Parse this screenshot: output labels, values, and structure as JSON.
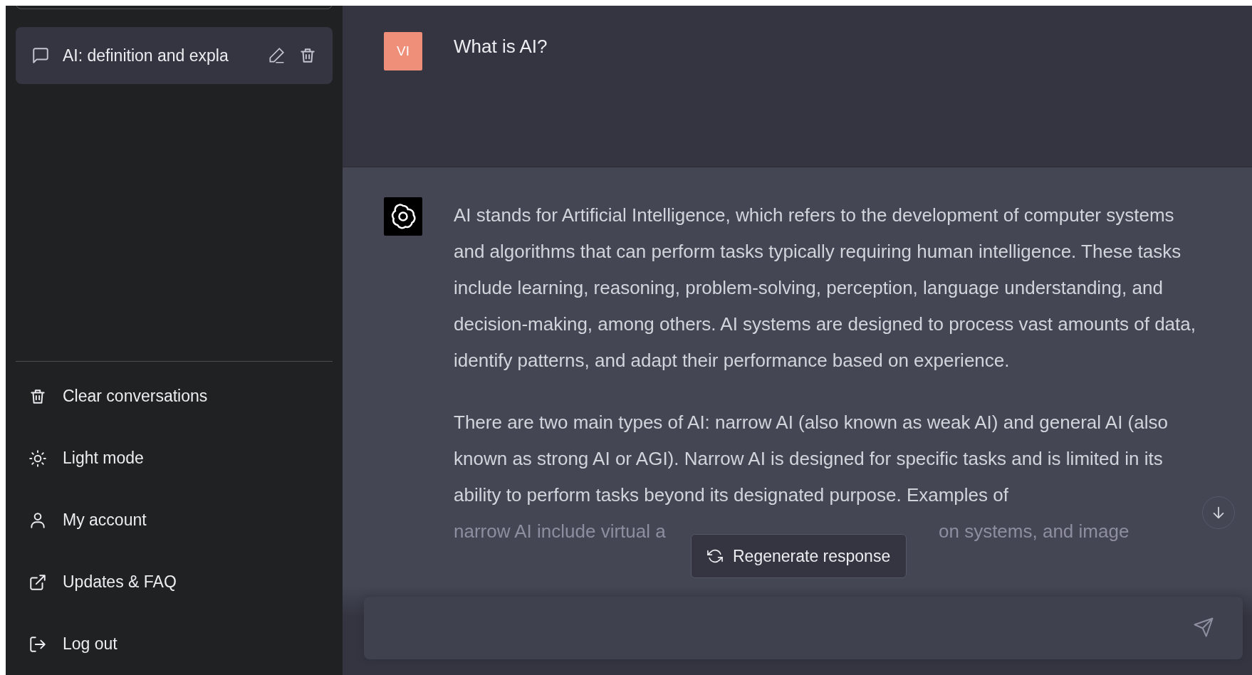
{
  "sidebar": {
    "conversations": [
      {
        "title": "AI: definition and expla",
        "selected": true
      }
    ],
    "menu": [
      {
        "label": "Clear conversations",
        "kind": "trash"
      },
      {
        "label": "Light mode",
        "kind": "sun"
      },
      {
        "label": "My account",
        "kind": "user"
      },
      {
        "label": "Updates & FAQ",
        "kind": "external"
      },
      {
        "label": "Log out",
        "kind": "logout"
      }
    ]
  },
  "chat": {
    "messages": [
      {
        "kind": "user",
        "avatar": "VI",
        "paragraphs": [
          "What is AI?"
        ]
      },
      {
        "kind": "assistant",
        "paragraphs": [
          "AI stands for Artificial Intelligence, which refers to the development of computer systems and algorithms that can perform tasks typically requiring human intelligence. These tasks include learning, reasoning, problem-solving, perception, language understanding, and decision-making, among others. AI systems are designed to process vast amounts of data, identify patterns, and adapt their performance based on experience.",
          "There are two main types of AI: narrow AI (also known as weak AI) and general AI (also known as strong AI or AGI). Narrow AI is designed for specific tasks and is limited in its ability to perform tasks beyond its designated purpose. Examples of"
        ],
        "faded_line": {
          "before": "narrow AI include virtual a",
          "after": "on systems, and image"
        }
      }
    ],
    "regenerate_button": "Regenerate response"
  }
}
